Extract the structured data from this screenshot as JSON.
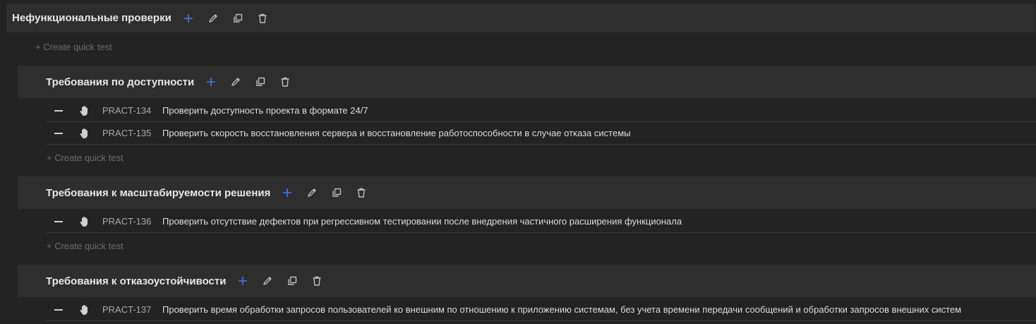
{
  "root_suite": {
    "title": "Нефункциональные проверки",
    "quick_test": "+ Create quick test"
  },
  "suites": [
    {
      "title": "Требования по доступности",
      "quick_test": "+ Create quick test",
      "cases": [
        {
          "id": "PRACT-134",
          "title": "Проверить доступность проекта в формате 24/7"
        },
        {
          "id": "PRACT-135",
          "title": "Проверить скорость восстановления сервера и восстановление работоспособности в случае отказа системы"
        }
      ]
    },
    {
      "title": "Требования к масштабируемости решения",
      "quick_test": "+ Create quick test",
      "cases": [
        {
          "id": "PRACT-136",
          "title": "Проверить отсутствие дефектов при регрессивном тестировании после внедрения частичного расширения функционала"
        }
      ]
    },
    {
      "title": "Требования к отказоустойчивости",
      "cases": [
        {
          "id": "PRACT-137",
          "title": "Проверить время обработки запросов пользователей ко внешним по отношению к приложению системам, без учета времени передачи сообщений и обработки запросов внешних систем"
        }
      ]
    }
  ],
  "icons": {
    "add": "plus-icon",
    "edit": "pencil-icon",
    "copy": "copy-icon",
    "delete": "trash-icon",
    "collapse": "minus-icon",
    "manual": "hand-icon"
  },
  "colors": {
    "accent": "#3d7bf0",
    "background": "#232323",
    "header": "#2e2e2e"
  }
}
